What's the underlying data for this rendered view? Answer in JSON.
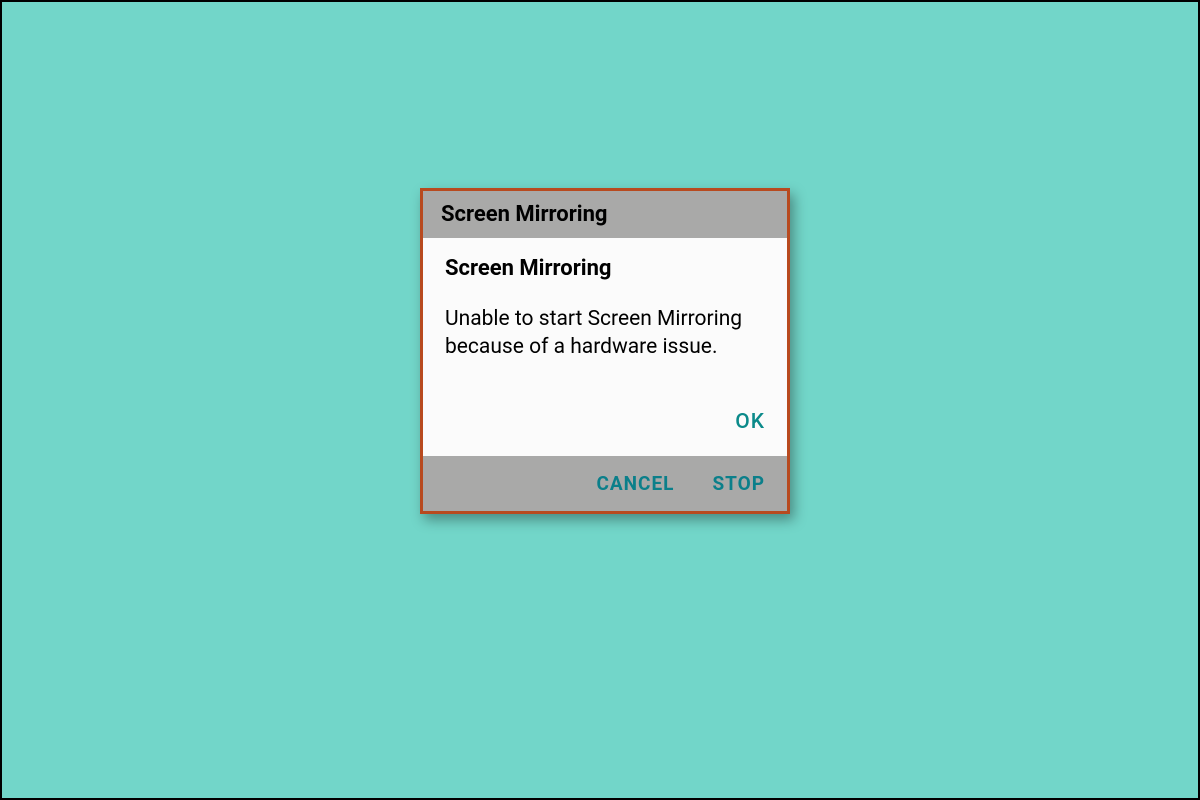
{
  "dialog": {
    "title": "Screen Mirroring",
    "subtitle": "Screen Mirroring",
    "message": "Unable to start Screen Mirroring because of a hardware issue.",
    "ok_label": "OK",
    "cancel_label": "CANCEL",
    "stop_label": "STOP"
  },
  "colors": {
    "background": "#72d6c9",
    "border": "#b84a1f",
    "header": "#a9a9a8",
    "accent": "#0b8a8a"
  }
}
